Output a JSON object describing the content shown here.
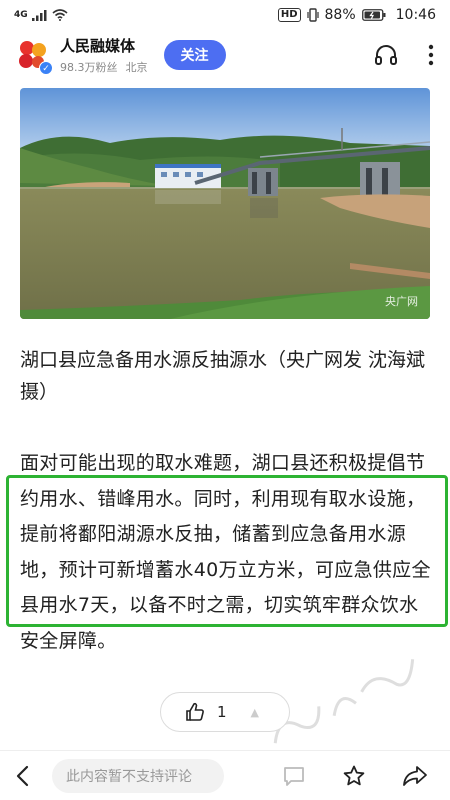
{
  "status_bar": {
    "network": "4G",
    "hd": "HD",
    "battery": "88%",
    "time": "10:46"
  },
  "header": {
    "account_name": "人民融媒体",
    "followers": "98.3万粉丝",
    "location": "北京",
    "follow_label": "关注",
    "icons": [
      "back",
      "headphones-icon",
      "more-icon"
    ]
  },
  "photo": {
    "watermark": "央广网"
  },
  "article": {
    "caption": "湖口县应急备用水源反抽源水（央广网发 沈海斌 摄）",
    "paragraph": "面对可能出现的取水难题，湖口县还积极提倡节约用水、错峰用水。同时，利用现有取水设施，提前将鄱阳湖源水反抽，储蓄到应急备用水源地，预计可新增蓄水40万立方米，可应急供应全县用水7天，以备不时之需，切实筑牢群众饮水安全屏障。"
  },
  "like": {
    "count": "1"
  },
  "bottom_bar": {
    "comment_placeholder": "此内容暂不支持评论"
  },
  "colors": {
    "accent": "#4d6ef2",
    "highlight": "#2db333"
  }
}
